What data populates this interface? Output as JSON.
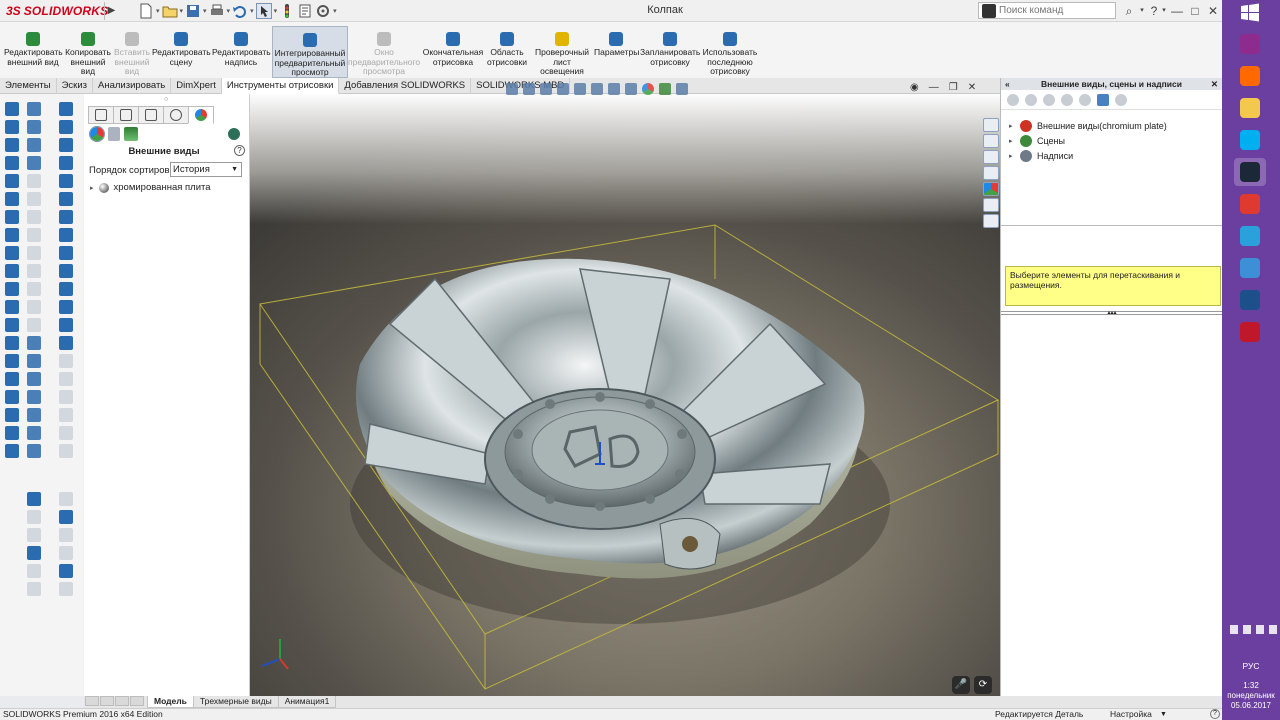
{
  "app": {
    "logo_ds": "3S",
    "logo_name": "SOLIDWORKS",
    "document_title": "Колпак",
    "search_placeholder": "Поиск команд",
    "help_label": "?",
    "minimize": "—",
    "maximize": "□",
    "close": "✕"
  },
  "ribbon": {
    "buttons": [
      {
        "label": "Редактировать внешний вид",
        "state": "normal",
        "color": "#2c8c3c"
      },
      {
        "label": "Копировать внешний вид",
        "state": "normal",
        "color": "#2c8c3c"
      },
      {
        "label": "Вставить внешний вид",
        "state": "disabled",
        "color": "#bcbcbc"
      },
      {
        "label": "Редактировать сцену",
        "state": "normal",
        "color": "#2b6cb0"
      },
      {
        "label": "Редактировать надпись",
        "state": "normal",
        "color": "#2b6cb0"
      },
      {
        "label": "Интегрированный предварительный просмотр",
        "state": "active",
        "color": "#2b6cb0"
      },
      {
        "label": "Окно предварительного просмотра",
        "state": "disabled",
        "color": "#bcbcbc"
      },
      {
        "label": "Окончательная отрисовка",
        "state": "normal",
        "color": "#2b6cb0"
      },
      {
        "label": "Область отрисовки",
        "state": "normal",
        "color": "#2b6cb0"
      },
      {
        "label": "Проверочный лист освещения сцены",
        "state": "normal",
        "color": "#e1b400"
      },
      {
        "label": "Параметры",
        "state": "normal",
        "color": "#2b6cb0"
      },
      {
        "label": "Запланировать отрисовку",
        "state": "normal",
        "color": "#2b6cb0"
      },
      {
        "label": "Использовать последнюю отрисовку",
        "state": "normal",
        "color": "#2b6cb0"
      }
    ]
  },
  "command_tabs": [
    {
      "label": "Элементы",
      "active": false
    },
    {
      "label": "Эскиз",
      "active": false
    },
    {
      "label": "Анализировать",
      "active": false
    },
    {
      "label": "DimXpert",
      "active": false
    },
    {
      "label": "Инструменты отрисовки",
      "active": true
    },
    {
      "label": "Добавления SOLIDWORKS",
      "active": false
    },
    {
      "label": "SOLIDWORKS MBD",
      "active": false
    }
  ],
  "panel": {
    "title": "Внешние виды",
    "sort_label": "Порядок сортировки:",
    "sort_value": "История",
    "tree_item": "хромированная плита",
    "help": "?"
  },
  "taskpane": {
    "title": "Внешние виды, сцены и надписи",
    "collapse_glyph": "«",
    "pin_glyph": "✕",
    "items": [
      {
        "label": "Внешние виды(chromium plate)",
        "icon": "appearance-ball-icon",
        "color": "#cc3322"
      },
      {
        "label": "Сцены",
        "icon": "scene-icon",
        "color": "#3d8a3d"
      },
      {
        "label": "Надписи",
        "icon": "decal-icon",
        "color": "#6f7a88"
      }
    ],
    "message": "Выберите элементы для перетаскивания и размещения.",
    "split_glyph": "▴▴▴"
  },
  "bottom_tabs": [
    {
      "label": "Модель",
      "active": true
    },
    {
      "label": "Трехмерные виды",
      "active": false
    },
    {
      "label": "Анимация1",
      "active": false
    }
  ],
  "status": {
    "left": "SOLIDWORKS Premium 2016 x64 Edition",
    "editing": "Редактируется Деталь",
    "customize": "Настройка",
    "dropdown": "▼",
    "help": "?"
  },
  "taskbar": {
    "apps": [
      {
        "name": "winrar-icon",
        "color": "#8e2b8e"
      },
      {
        "name": "mi-icon",
        "color": "#ff6900"
      },
      {
        "name": "explorer-icon",
        "color": "#f2c94c"
      },
      {
        "name": "skype-icon",
        "color": "#00aff0"
      },
      {
        "name": "steam-icon",
        "color": "#1b2838"
      },
      {
        "name": "chrome-icon",
        "color": "#de3a2f"
      },
      {
        "name": "telegram-icon",
        "color": "#2aa1da"
      },
      {
        "name": "vm-icon",
        "color": "#3d8fd6"
      },
      {
        "name": "screen-icon",
        "color": "#1d4f8a"
      },
      {
        "name": "solidworks-icon",
        "color": "#c0182b"
      }
    ],
    "lang": "РУС",
    "time": "1:32",
    "day": "понедельник",
    "date": "05.06.2017"
  },
  "colors": {
    "accent": "#2b6cb0",
    "taskbar": "#6b3fa0",
    "message_bg": "#ffff88",
    "bbox": "#c9bd38"
  }
}
